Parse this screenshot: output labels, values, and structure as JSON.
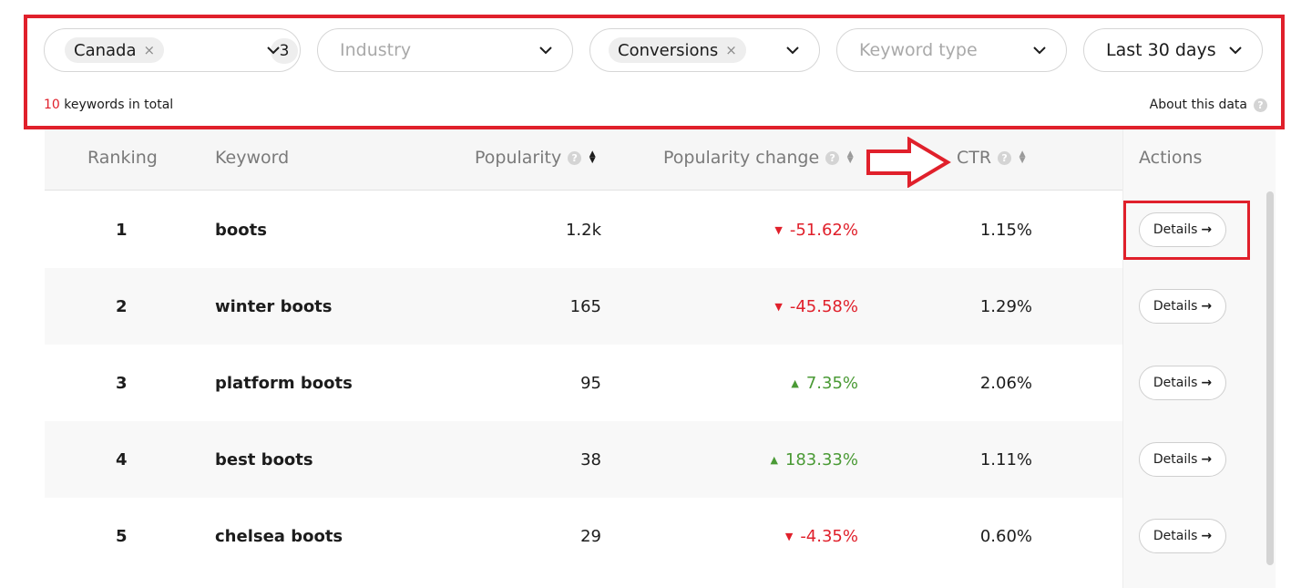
{
  "filters": {
    "country": {
      "tag": "Canada",
      "remove": "×",
      "count": "3"
    },
    "industry": {
      "placeholder": "Industry"
    },
    "goal": {
      "tag": "Conversions",
      "remove": "×"
    },
    "keyword_type": {
      "placeholder": "Keyword type"
    },
    "date_range": {
      "value": "Last 30 days"
    }
  },
  "summary": {
    "count": "10",
    "text": " keywords in total",
    "about": "About this data",
    "help": "?"
  },
  "table": {
    "headers": {
      "ranking": "Ranking",
      "keyword": "Keyword",
      "popularity": "Popularity",
      "popularity_change": "Popularity change",
      "ctr": "CTR",
      "actions": "Actions"
    },
    "rows": [
      {
        "rank": "1",
        "keyword": "boots",
        "popularity": "1.2k",
        "change": "-51.62%",
        "ctr": "1.15%",
        "details": "Details"
      },
      {
        "rank": "2",
        "keyword": "winter boots",
        "popularity": "165",
        "change": "-45.58%",
        "ctr": "1.29%",
        "details": "Details"
      },
      {
        "rank": "3",
        "keyword": "platform boots",
        "popularity": "95",
        "change": "7.35%",
        "ctr": "2.06%",
        "details": "Details"
      },
      {
        "rank": "4",
        "keyword": "best boots",
        "popularity": "38",
        "change": "183.33%",
        "ctr": "1.11%",
        "details": "Details"
      },
      {
        "rank": "5",
        "keyword": "chelsea boots",
        "popularity": "29",
        "change": "-4.35%",
        "ctr": "0.60%",
        "details": "Details"
      }
    ]
  },
  "icons": {
    "help": "question-circle-icon",
    "sort": "sort-icon",
    "chevron": "chevron-down-icon",
    "arrow": "arrow-right-icon"
  },
  "colors": {
    "accent": "#e0202b",
    "negative": "#e0202b",
    "positive": "#4a9a35",
    "annotation": "#e0202b"
  }
}
